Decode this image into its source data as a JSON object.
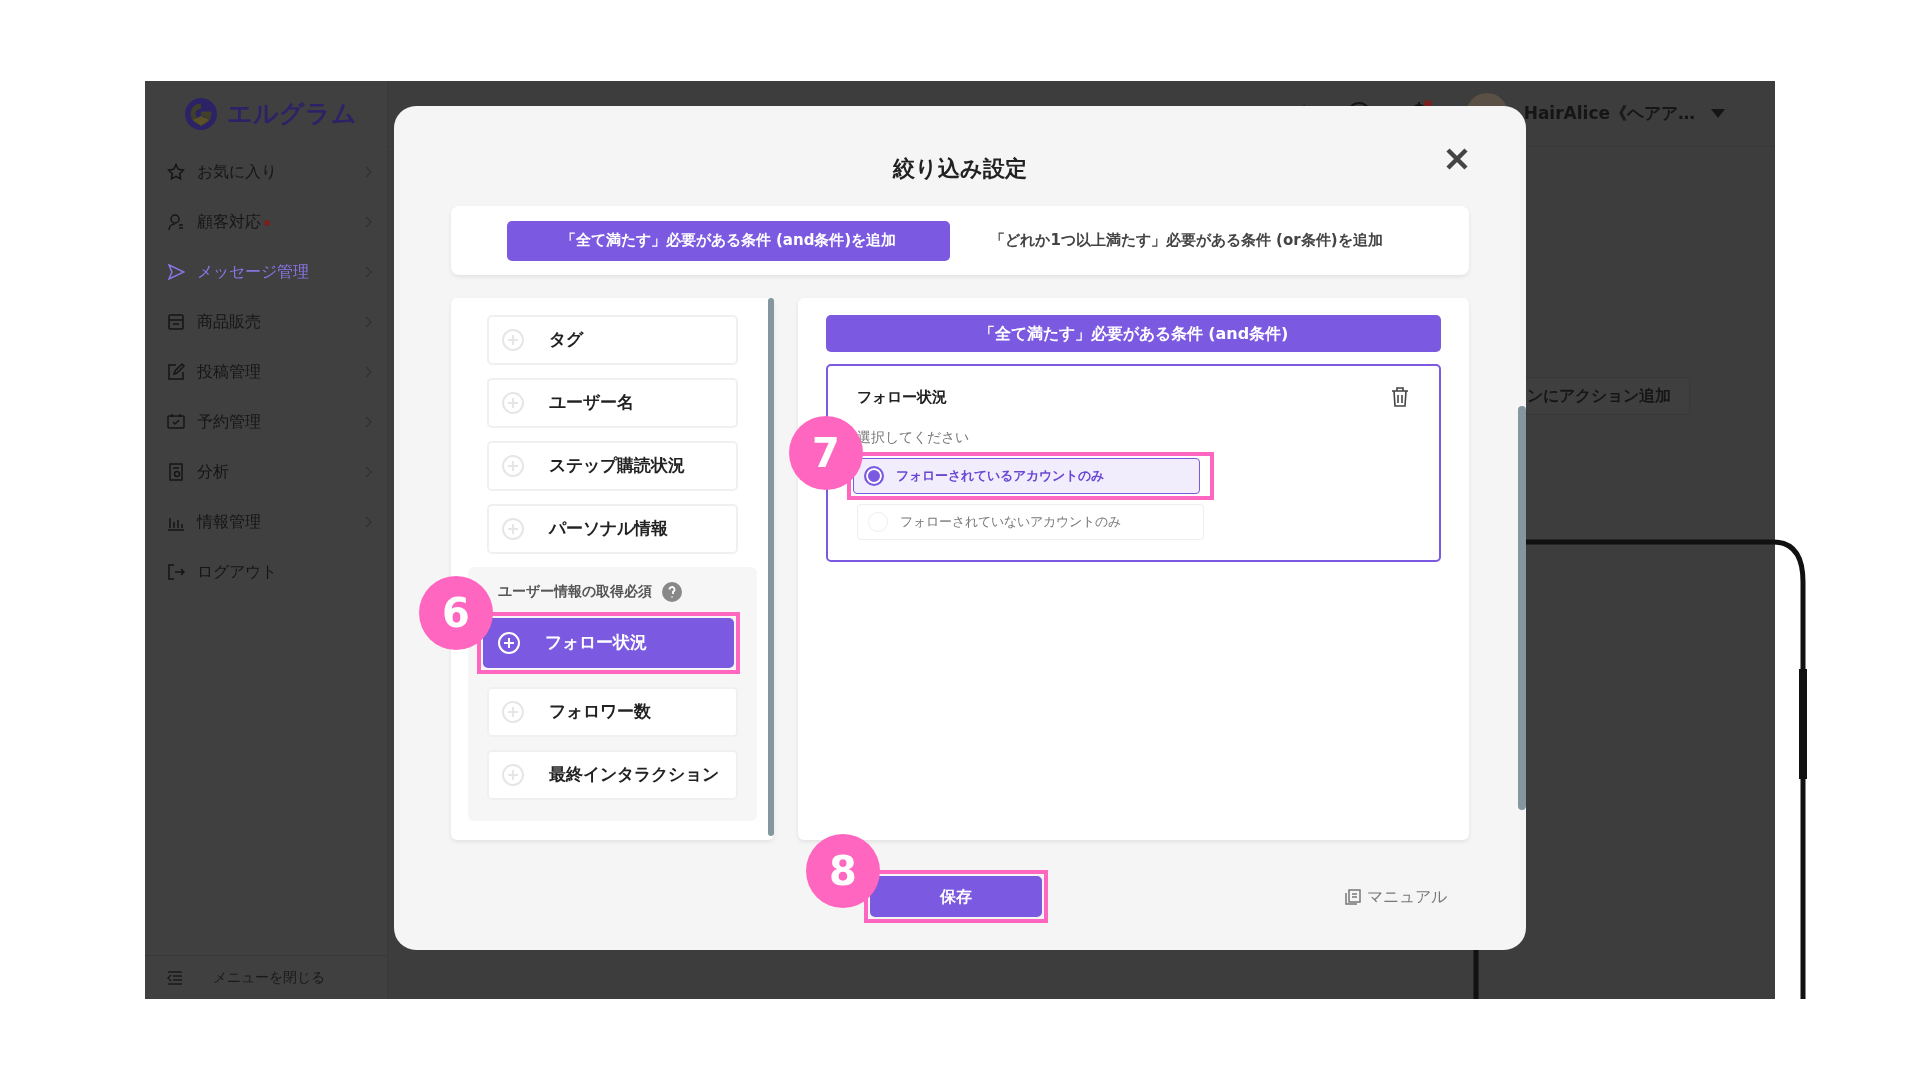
{
  "sidebar": {
    "logo": "エルグラム",
    "items": [
      {
        "label": "お気に入り",
        "selected": false,
        "submenu": true,
        "alert": false
      },
      {
        "label": "顧客対応",
        "selected": false,
        "submenu": true,
        "alert": true
      },
      {
        "label": "メッセージ管理",
        "selected": true,
        "submenu": true,
        "alert": false
      },
      {
        "label": "商品販売",
        "selected": false,
        "submenu": true,
        "alert": false
      },
      {
        "label": "投稿管理",
        "selected": false,
        "submenu": true,
        "alert": false
      },
      {
        "label": "予約管理",
        "selected": false,
        "submenu": true,
        "alert": false
      },
      {
        "label": "分析",
        "selected": false,
        "submenu": true,
        "alert": false
      },
      {
        "label": "情報管理",
        "selected": false,
        "submenu": true,
        "alert": false
      },
      {
        "label": "ログアウト",
        "selected": false,
        "submenu": false,
        "alert": false
      }
    ],
    "collapse": "メニューを閉じる"
  },
  "header": {
    "unread": true,
    "user": "HairAlice《ヘアア…"
  },
  "background": {
    "action_button": "ンにアクション追加"
  },
  "modal": {
    "title": "絞り込み設定",
    "tabs": [
      {
        "label": "「全て満たす」必要がある条件 (and条件)を追加",
        "selected": true
      },
      {
        "label": "「どれか1つ以上満たす」必要がある条件 (or条件)を追加",
        "selected": false
      }
    ],
    "condition_groups": [
      {
        "items": [
          {
            "label": "タグ",
            "selected": false
          },
          {
            "label": "ユーザー名",
            "selected": false
          },
          {
            "label": "ステップ購読状況",
            "selected": false
          },
          {
            "label": "パーソナル情報",
            "selected": false
          }
        ]
      },
      {
        "title": "ユーザー情報の取得必須",
        "items": [
          {
            "label": "フォロー状況",
            "selected": true,
            "callout": "6"
          },
          {
            "label": "フォロワー数",
            "selected": false
          },
          {
            "label": "最終インタラクション",
            "selected": false
          }
        ]
      }
    ],
    "condition_set": {
      "title": "「全て満たす」必要がある条件 (and条件)",
      "conditions": [
        {
          "title": "フォロー状況",
          "prompt": "選択してください",
          "options": [
            {
              "label": "フォローされているアカウントのみ",
              "selected": true,
              "callout": "7"
            },
            {
              "label": "フォローされていないアカウントのみ",
              "selected": false
            }
          ]
        }
      ]
    },
    "save": {
      "label": "保存",
      "callout": "8"
    },
    "manual": "マニュアル"
  }
}
